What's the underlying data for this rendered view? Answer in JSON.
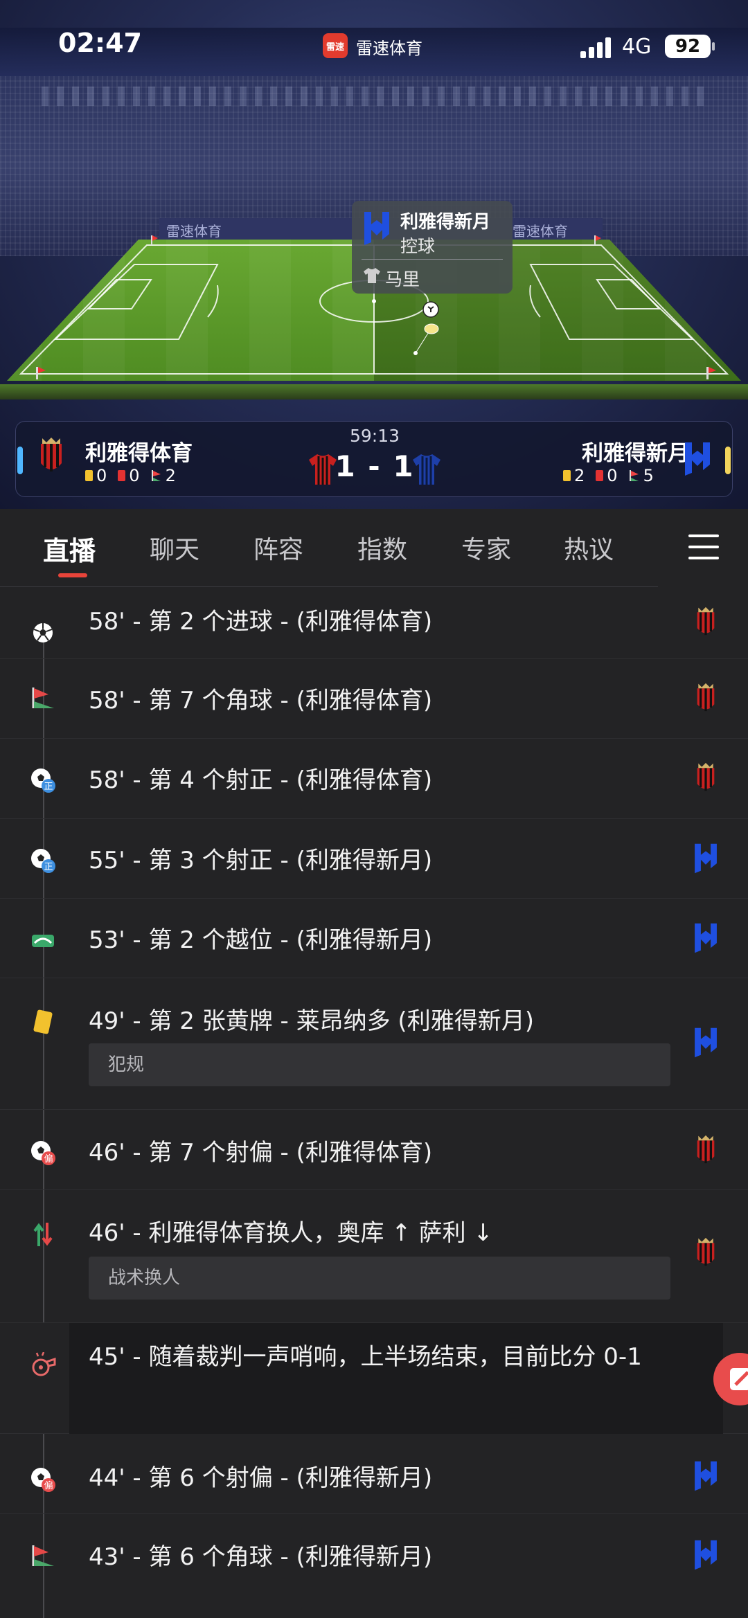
{
  "status_bar": {
    "time": "02:47",
    "app_badge": "雷速",
    "app_name": "雷速体育",
    "network": "4G",
    "battery": "92"
  },
  "stadium": {
    "board_text": "雷速体育"
  },
  "popup": {
    "team": "利雅得新月",
    "action": "控球",
    "player": "马里"
  },
  "scoreboard": {
    "match_time": "59:13",
    "score": "1 - 1",
    "home": {
      "name": "利雅得体育",
      "yellow": "0",
      "red": "0",
      "corners": "2"
    },
    "away": {
      "name": "利雅得新月",
      "yellow": "2",
      "red": "0",
      "corners": "5"
    }
  },
  "tabs": [
    "直播",
    "聊天",
    "阵容",
    "指数",
    "专家",
    "热议"
  ],
  "events": [
    {
      "icon": "goal-icon",
      "text": "58' - 第 2 个进球 - (利雅得体育)",
      "team": "home"
    },
    {
      "icon": "corner-icon",
      "text": "58' - 第 7 个角球 - (利雅得体育)",
      "team": "home"
    },
    {
      "icon": "shot-on-target-icon",
      "badge": "正",
      "text": "58' - 第 4 个射正 - (利雅得体育)",
      "team": "home"
    },
    {
      "icon": "shot-on-target-icon",
      "badge": "正",
      "text": "55' - 第 3 个射正 - (利雅得新月)",
      "team": "away"
    },
    {
      "icon": "offside-icon",
      "text": "53' - 第 2 个越位 - (利雅得新月)",
      "team": "away"
    },
    {
      "icon": "yellow-card-icon",
      "text": "49' - 第 2 张黄牌 - 莱昂纳多 (利雅得新月)",
      "sub": "犯规",
      "team": "away"
    },
    {
      "icon": "shot-off-target-icon",
      "badge": "偏",
      "text": "46' - 第 7 个射偏 - (利雅得体育)",
      "team": "home"
    },
    {
      "icon": "substitution-icon",
      "text": "46' - 利雅得体育换人，奥库 ↑ 萨利 ↓",
      "sub": "战术换人",
      "team": "home"
    },
    {
      "icon": "whistle-icon",
      "text": "45' - 随着裁判一声哨响，上半场结束，目前比分 0-1",
      "team": ""
    },
    {
      "icon": "shot-off-target-icon",
      "badge": "偏",
      "text": "44' - 第 6 个射偏 - (利雅得新月)",
      "team": "away"
    },
    {
      "icon": "corner-icon",
      "text": "43' - 第 6 个角球 - (利雅得新月)",
      "team": "away"
    }
  ],
  "colors": {
    "accent": "#e8443a",
    "home": "#c8201f",
    "away": "#1f4fe0",
    "yellow_card": "#f2c12e"
  }
}
